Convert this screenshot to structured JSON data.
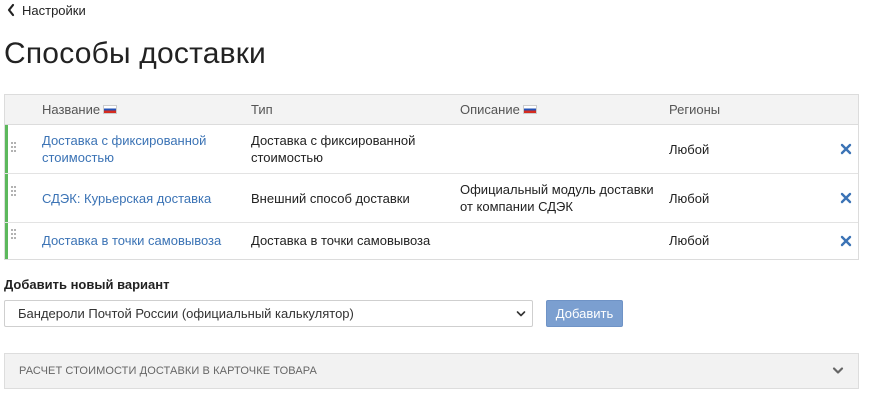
{
  "breadcrumb": {
    "back_label": "Настройки"
  },
  "page": {
    "title": "Способы доставки"
  },
  "table": {
    "headers": {
      "name": "Название",
      "type": "Тип",
      "description": "Описание",
      "regions": "Регионы"
    },
    "rows": [
      {
        "name": "Доставка с фиксированной стоимостью",
        "type": "Доставка с фиксированной стоимостью",
        "description": "",
        "regions": "Любой"
      },
      {
        "name": "СДЭК: Курьерская доставка",
        "type": "Внешний способ доставки",
        "description": "Официальный модуль доставки от компании СДЭК",
        "regions": "Любой"
      },
      {
        "name": "Доставка в точки самовывоза",
        "type": "Доставка в точки самовывоза",
        "description": "",
        "regions": "Любой"
      }
    ]
  },
  "add_new": {
    "label": "Добавить новый вариант",
    "selected": "Бандероли Почтой России (официальный калькулятор)",
    "button": "Добавить"
  },
  "accordion": {
    "label": "РАСЧЕТ СТОИМОСТИ ДОСТАВКИ В КАРТОЧКЕ ТОВАРА"
  },
  "colors": {
    "link": "#3b73b5",
    "active_bar": "#5cb85c",
    "button": "#7b9fd0",
    "remove_icon": "#3b73b5"
  },
  "icons": {
    "back": "chevron-left-icon",
    "flag": "russian-flag-icon",
    "drag": "drag-handle-icon",
    "remove": "close-icon",
    "select": "chevron-down-icon",
    "accordion": "chevron-down-icon"
  }
}
